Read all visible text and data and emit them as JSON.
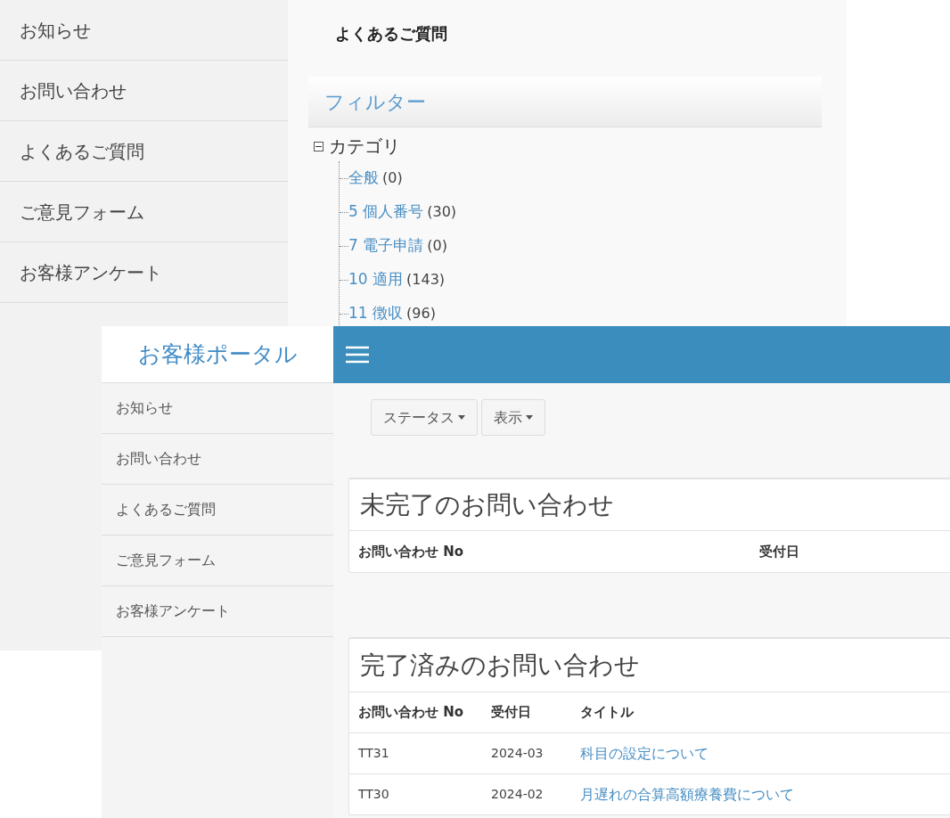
{
  "back_window": {
    "sidebar": {
      "items": [
        {
          "label": "お知らせ"
        },
        {
          "label": "お問い合わせ"
        },
        {
          "label": "よくあるご質問"
        },
        {
          "label": "ご意見フォーム"
        },
        {
          "label": "お客様アンケート"
        }
      ]
    },
    "page_title": "よくあるご質問",
    "filter": {
      "title": "フィルター",
      "tree": {
        "label": "カテゴリ",
        "expanded": true,
        "children": [
          {
            "label": "全般",
            "count": "(0)"
          },
          {
            "label": "5 個人番号",
            "count": "(30)"
          },
          {
            "label": "7 電子申請",
            "count": "(0)"
          },
          {
            "label": "10 適用",
            "count": "(143)"
          },
          {
            "label": "11 徴収",
            "count": "(96)"
          }
        ]
      }
    }
  },
  "front_window": {
    "brand": "お客様ポータル",
    "sidebar": {
      "items": [
        {
          "label": "お知らせ"
        },
        {
          "label": "お問い合わせ"
        },
        {
          "label": "よくあるご質問"
        },
        {
          "label": "ご意見フォーム"
        },
        {
          "label": "お客様アンケート"
        }
      ]
    },
    "toolbar": {
      "buttons": [
        {
          "label": "ステータス"
        },
        {
          "label": "表示"
        }
      ]
    },
    "open_inquiries": {
      "title": "未完了のお問い合わせ",
      "columns": [
        "お問い合わせ No",
        "受付日"
      ]
    },
    "closed_inquiries": {
      "title": "完了済みのお問い合わせ",
      "columns": [
        "お問い合わせ No",
        "受付日",
        "タイトル"
      ],
      "rows": [
        {
          "no": "TT31",
          "date": "2024-03",
          "title": "科目の設定について"
        },
        {
          "no": "TT30",
          "date": "2024-02",
          "title": "月遅れの合算高額療養費について"
        }
      ]
    }
  }
}
